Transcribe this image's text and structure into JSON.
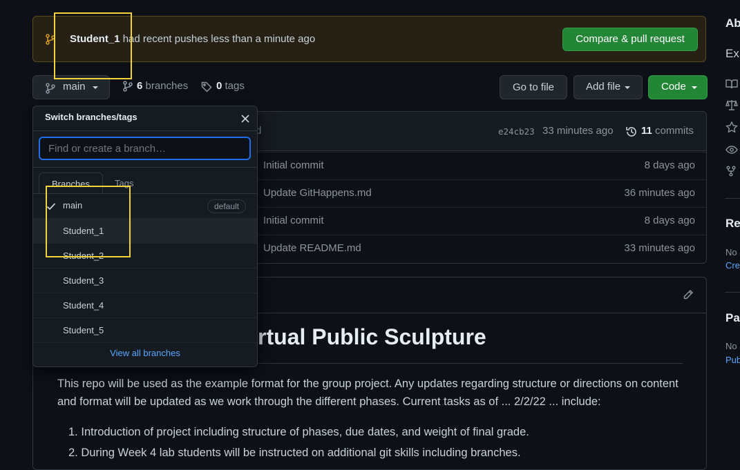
{
  "banner": {
    "branch_name": "Student_1",
    "message": "had recent pushes less than a minute ago",
    "compare_button": "Compare & pull request"
  },
  "toolbar": {
    "current_branch": "main",
    "branches_count": "6",
    "branches_label": "branches",
    "tags_count": "0",
    "tags_label": "tags",
    "go_to_file": "Go to file",
    "add_file": "Add file",
    "code": "Code"
  },
  "commit_header": {
    "partial_text": "d",
    "sha": "e24cb23",
    "time": "33 minutes ago",
    "commits_count": "11",
    "commits_label": "commits"
  },
  "file_rows": [
    {
      "commit": "Initial commit",
      "time": "8 days ago"
    },
    {
      "commit": "Update GitHappens.md",
      "time": "36 minutes ago"
    },
    {
      "commit": "Initial commit",
      "time": "8 days ago"
    },
    {
      "commit": "Update README.md",
      "time": "33 minutes ago"
    }
  ],
  "readme": {
    "heading_visible": "rtual Public Sculpture",
    "paragraph": "This repo will be used as the example format for the group project. Any updates regarding structure or directions on content and format will be updated as we work through the different phases. Current tasks as of ... 2/2/22 ... include:",
    "list": [
      "Introduction of project including structure of phases, due dates, and weight of final grade.",
      "During Week 4 lab students will be instructed on additional git skills including branches."
    ]
  },
  "dropdown": {
    "title": "Switch branches/tags",
    "placeholder": "Find or create a branch…",
    "tabs": [
      "Branches",
      "Tags"
    ],
    "branches": [
      "main",
      "Student_1",
      "Student_2",
      "Student_3",
      "Student_4",
      "Student_5"
    ],
    "default_badge": "default",
    "view_all": "View all branches"
  },
  "sidebar": {
    "about_heading": "Ab",
    "about_text": "Ex",
    "releases_heading": "Re",
    "releases_text": "No",
    "releases_link": "Cre",
    "packages_heading": "Pa",
    "packages_text": "No",
    "packages_link": "Pub"
  },
  "colors": {
    "background": "#0d1117",
    "accent_green": "#238636",
    "link_blue": "#58a6ff",
    "highlight_yellow": "#f2d43a"
  }
}
